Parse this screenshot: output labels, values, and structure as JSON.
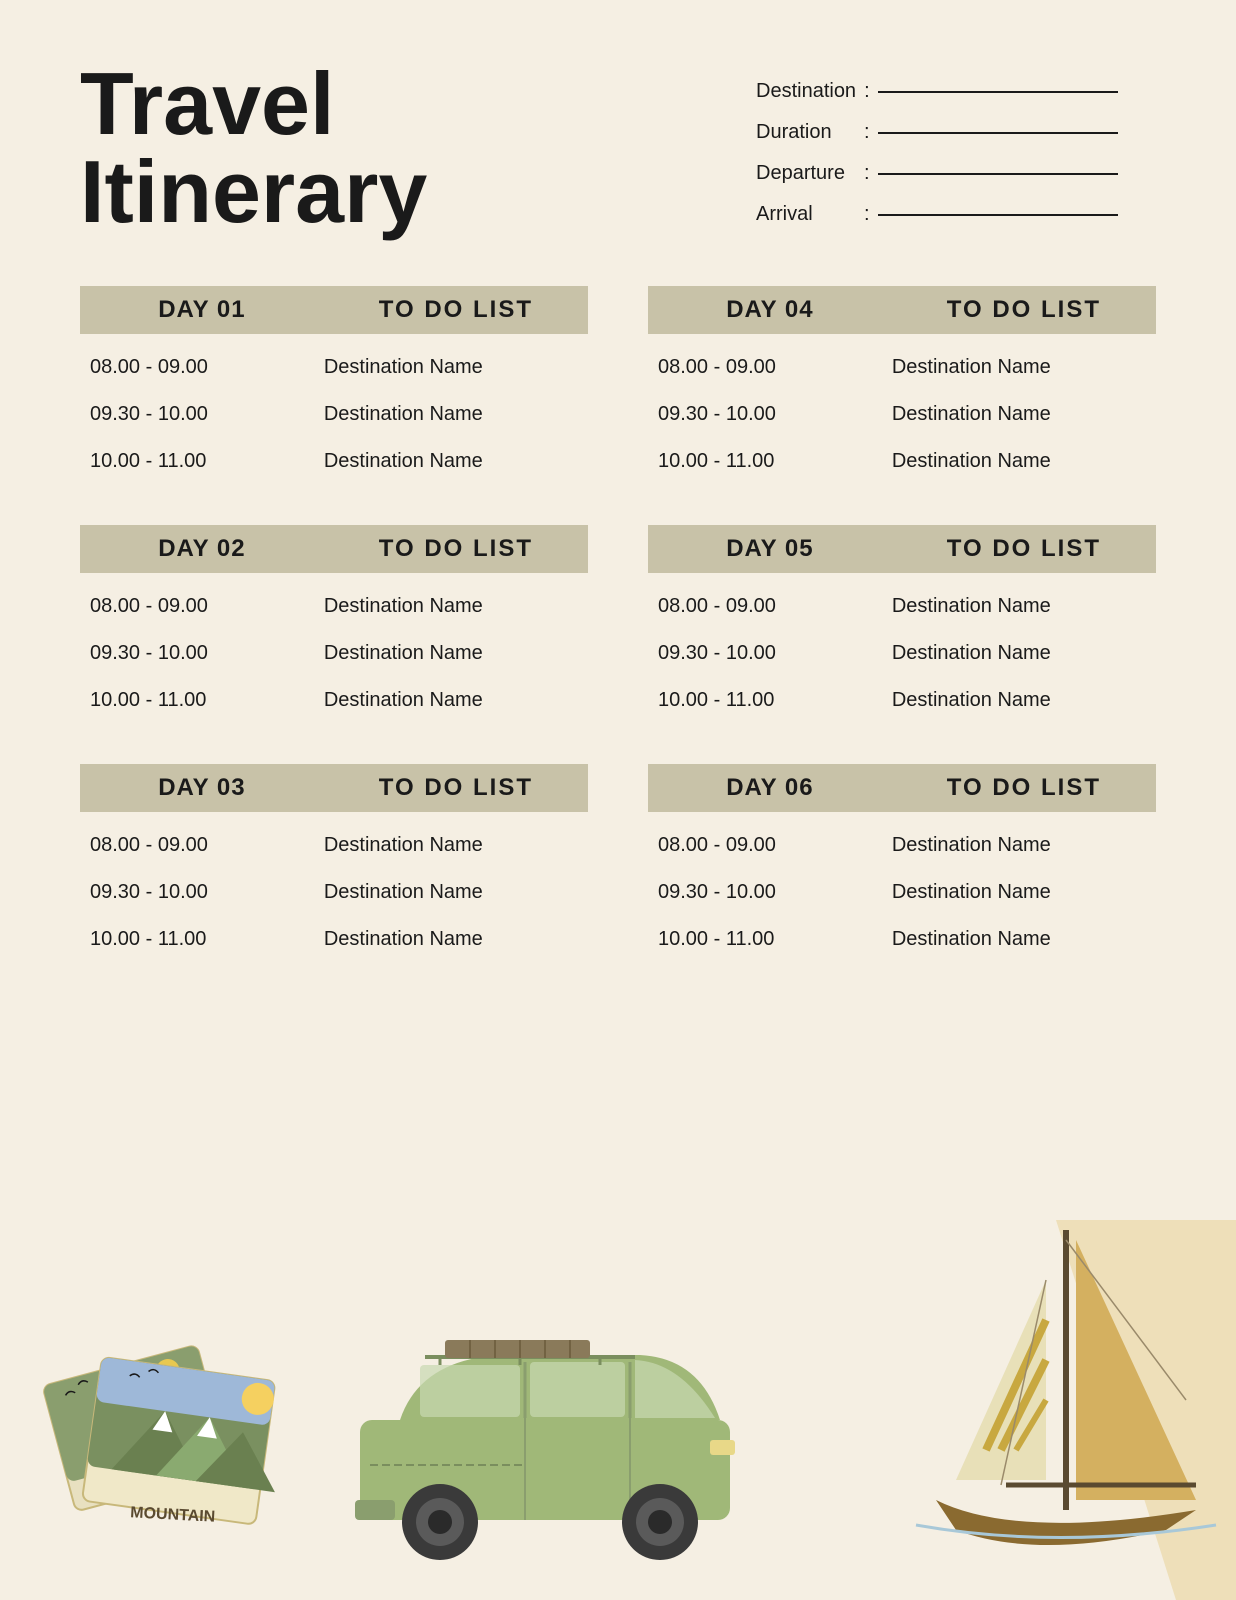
{
  "header": {
    "title_line1": "Travel",
    "title_line2": "Itinerary",
    "fields": [
      {
        "label": "Destination",
        "colon": ":"
      },
      {
        "label": "Duration",
        "colon": ":"
      },
      {
        "label": "Departure",
        "colon": ":"
      },
      {
        "label": "Arrival",
        "colon": ":"
      }
    ]
  },
  "days": [
    {
      "id": "day01",
      "day_label": "DAY 01",
      "todo_label": "TO DO LIST",
      "rows": [
        {
          "time": "08.00 - 09.00",
          "destination": "Destination Name"
        },
        {
          "time": "09.30 - 10.00",
          "destination": "Destination Name"
        },
        {
          "time": "10.00 - 11.00",
          "destination": "Destination Name"
        }
      ]
    },
    {
      "id": "day04",
      "day_label": "DAY 04",
      "todo_label": "TO DO LIST",
      "rows": [
        {
          "time": "08.00 - 09.00",
          "destination": "Destination Name"
        },
        {
          "time": "09.30 - 10.00",
          "destination": "Destination Name"
        },
        {
          "time": "10.00 - 11.00",
          "destination": "Destination Name"
        }
      ]
    },
    {
      "id": "day02",
      "day_label": "DAY 02",
      "todo_label": "TO DO LIST",
      "rows": [
        {
          "time": "08.00 - 09.00",
          "destination": "Destination Name"
        },
        {
          "time": "09.30 - 10.00",
          "destination": "Destination Name"
        },
        {
          "time": "10.00 - 11.00",
          "destination": "Destination Name"
        }
      ]
    },
    {
      "id": "day05",
      "day_label": "DAY 05",
      "todo_label": "TO DO LIST",
      "rows": [
        {
          "time": "08.00 - 09.00",
          "destination": "Destination Name"
        },
        {
          "time": "09.30 - 10.00",
          "destination": "Destination Name"
        },
        {
          "time": "10.00 - 11.00",
          "destination": "Destination Name"
        }
      ]
    },
    {
      "id": "day03",
      "day_label": "DAY 03",
      "todo_label": "TO DO LIST",
      "rows": [
        {
          "time": "08.00 - 09.00",
          "destination": "Destination Name"
        },
        {
          "time": "09.30 - 10.00",
          "destination": "Destination Name"
        },
        {
          "time": "10.00 - 11.00",
          "destination": "Destination Name"
        }
      ]
    },
    {
      "id": "day06",
      "day_label": "DAY 06",
      "todo_label": "TO DO LIST",
      "rows": [
        {
          "time": "08.00 - 09.00",
          "destination": "Destination Name"
        },
        {
          "time": "09.30 - 10.00",
          "destination": "Destination Name"
        },
        {
          "time": "10.00 - 11.00",
          "destination": "Destination Name"
        }
      ]
    }
  ],
  "colors": {
    "bg": "#f5efe3",
    "header_bar": "#c8c2a8",
    "text_dark": "#1a1a1a",
    "green_muted": "#8a9e6e",
    "tan": "#c8b87a",
    "card_bg": "#d4cba0"
  }
}
